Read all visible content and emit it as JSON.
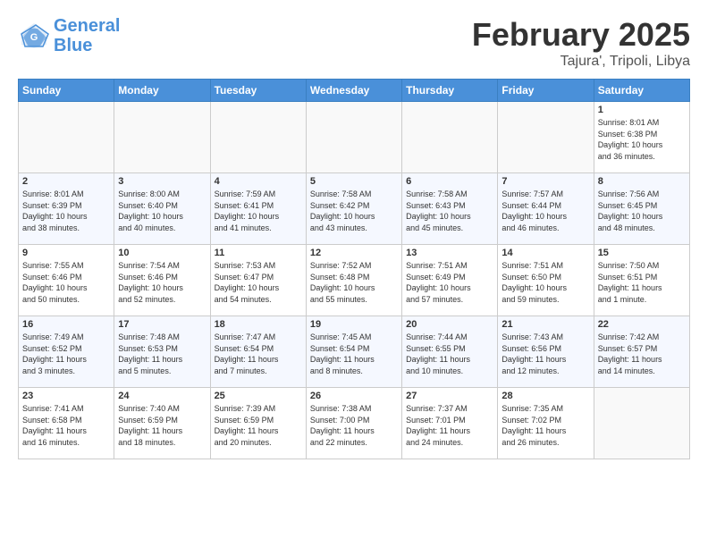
{
  "header": {
    "logo_line1": "General",
    "logo_line2": "Blue",
    "title": "February 2025",
    "subtitle": "Tajura', Tripoli, Libya"
  },
  "days_of_week": [
    "Sunday",
    "Monday",
    "Tuesday",
    "Wednesday",
    "Thursday",
    "Friday",
    "Saturday"
  ],
  "weeks": [
    [
      {
        "day": "",
        "info": ""
      },
      {
        "day": "",
        "info": ""
      },
      {
        "day": "",
        "info": ""
      },
      {
        "day": "",
        "info": ""
      },
      {
        "day": "",
        "info": ""
      },
      {
        "day": "",
        "info": ""
      },
      {
        "day": "1",
        "info": "Sunrise: 8:01 AM\nSunset: 6:38 PM\nDaylight: 10 hours\nand 36 minutes."
      }
    ],
    [
      {
        "day": "2",
        "info": "Sunrise: 8:01 AM\nSunset: 6:39 PM\nDaylight: 10 hours\nand 38 minutes."
      },
      {
        "day": "3",
        "info": "Sunrise: 8:00 AM\nSunset: 6:40 PM\nDaylight: 10 hours\nand 40 minutes."
      },
      {
        "day": "4",
        "info": "Sunrise: 7:59 AM\nSunset: 6:41 PM\nDaylight: 10 hours\nand 41 minutes."
      },
      {
        "day": "5",
        "info": "Sunrise: 7:58 AM\nSunset: 6:42 PM\nDaylight: 10 hours\nand 43 minutes."
      },
      {
        "day": "6",
        "info": "Sunrise: 7:58 AM\nSunset: 6:43 PM\nDaylight: 10 hours\nand 45 minutes."
      },
      {
        "day": "7",
        "info": "Sunrise: 7:57 AM\nSunset: 6:44 PM\nDaylight: 10 hours\nand 46 minutes."
      },
      {
        "day": "8",
        "info": "Sunrise: 7:56 AM\nSunset: 6:45 PM\nDaylight: 10 hours\nand 48 minutes."
      }
    ],
    [
      {
        "day": "9",
        "info": "Sunrise: 7:55 AM\nSunset: 6:46 PM\nDaylight: 10 hours\nand 50 minutes."
      },
      {
        "day": "10",
        "info": "Sunrise: 7:54 AM\nSunset: 6:46 PM\nDaylight: 10 hours\nand 52 minutes."
      },
      {
        "day": "11",
        "info": "Sunrise: 7:53 AM\nSunset: 6:47 PM\nDaylight: 10 hours\nand 54 minutes."
      },
      {
        "day": "12",
        "info": "Sunrise: 7:52 AM\nSunset: 6:48 PM\nDaylight: 10 hours\nand 55 minutes."
      },
      {
        "day": "13",
        "info": "Sunrise: 7:51 AM\nSunset: 6:49 PM\nDaylight: 10 hours\nand 57 minutes."
      },
      {
        "day": "14",
        "info": "Sunrise: 7:51 AM\nSunset: 6:50 PM\nDaylight: 10 hours\nand 59 minutes."
      },
      {
        "day": "15",
        "info": "Sunrise: 7:50 AM\nSunset: 6:51 PM\nDaylight: 11 hours\nand 1 minute."
      }
    ],
    [
      {
        "day": "16",
        "info": "Sunrise: 7:49 AM\nSunset: 6:52 PM\nDaylight: 11 hours\nand 3 minutes."
      },
      {
        "day": "17",
        "info": "Sunrise: 7:48 AM\nSunset: 6:53 PM\nDaylight: 11 hours\nand 5 minutes."
      },
      {
        "day": "18",
        "info": "Sunrise: 7:47 AM\nSunset: 6:54 PM\nDaylight: 11 hours\nand 7 minutes."
      },
      {
        "day": "19",
        "info": "Sunrise: 7:45 AM\nSunset: 6:54 PM\nDaylight: 11 hours\nand 8 minutes."
      },
      {
        "day": "20",
        "info": "Sunrise: 7:44 AM\nSunset: 6:55 PM\nDaylight: 11 hours\nand 10 minutes."
      },
      {
        "day": "21",
        "info": "Sunrise: 7:43 AM\nSunset: 6:56 PM\nDaylight: 11 hours\nand 12 minutes."
      },
      {
        "day": "22",
        "info": "Sunrise: 7:42 AM\nSunset: 6:57 PM\nDaylight: 11 hours\nand 14 minutes."
      }
    ],
    [
      {
        "day": "23",
        "info": "Sunrise: 7:41 AM\nSunset: 6:58 PM\nDaylight: 11 hours\nand 16 minutes."
      },
      {
        "day": "24",
        "info": "Sunrise: 7:40 AM\nSunset: 6:59 PM\nDaylight: 11 hours\nand 18 minutes."
      },
      {
        "day": "25",
        "info": "Sunrise: 7:39 AM\nSunset: 6:59 PM\nDaylight: 11 hours\nand 20 minutes."
      },
      {
        "day": "26",
        "info": "Sunrise: 7:38 AM\nSunset: 7:00 PM\nDaylight: 11 hours\nand 22 minutes."
      },
      {
        "day": "27",
        "info": "Sunrise: 7:37 AM\nSunset: 7:01 PM\nDaylight: 11 hours\nand 24 minutes."
      },
      {
        "day": "28",
        "info": "Sunrise: 7:35 AM\nSunset: 7:02 PM\nDaylight: 11 hours\nand 26 minutes."
      },
      {
        "day": "",
        "info": ""
      }
    ]
  ]
}
